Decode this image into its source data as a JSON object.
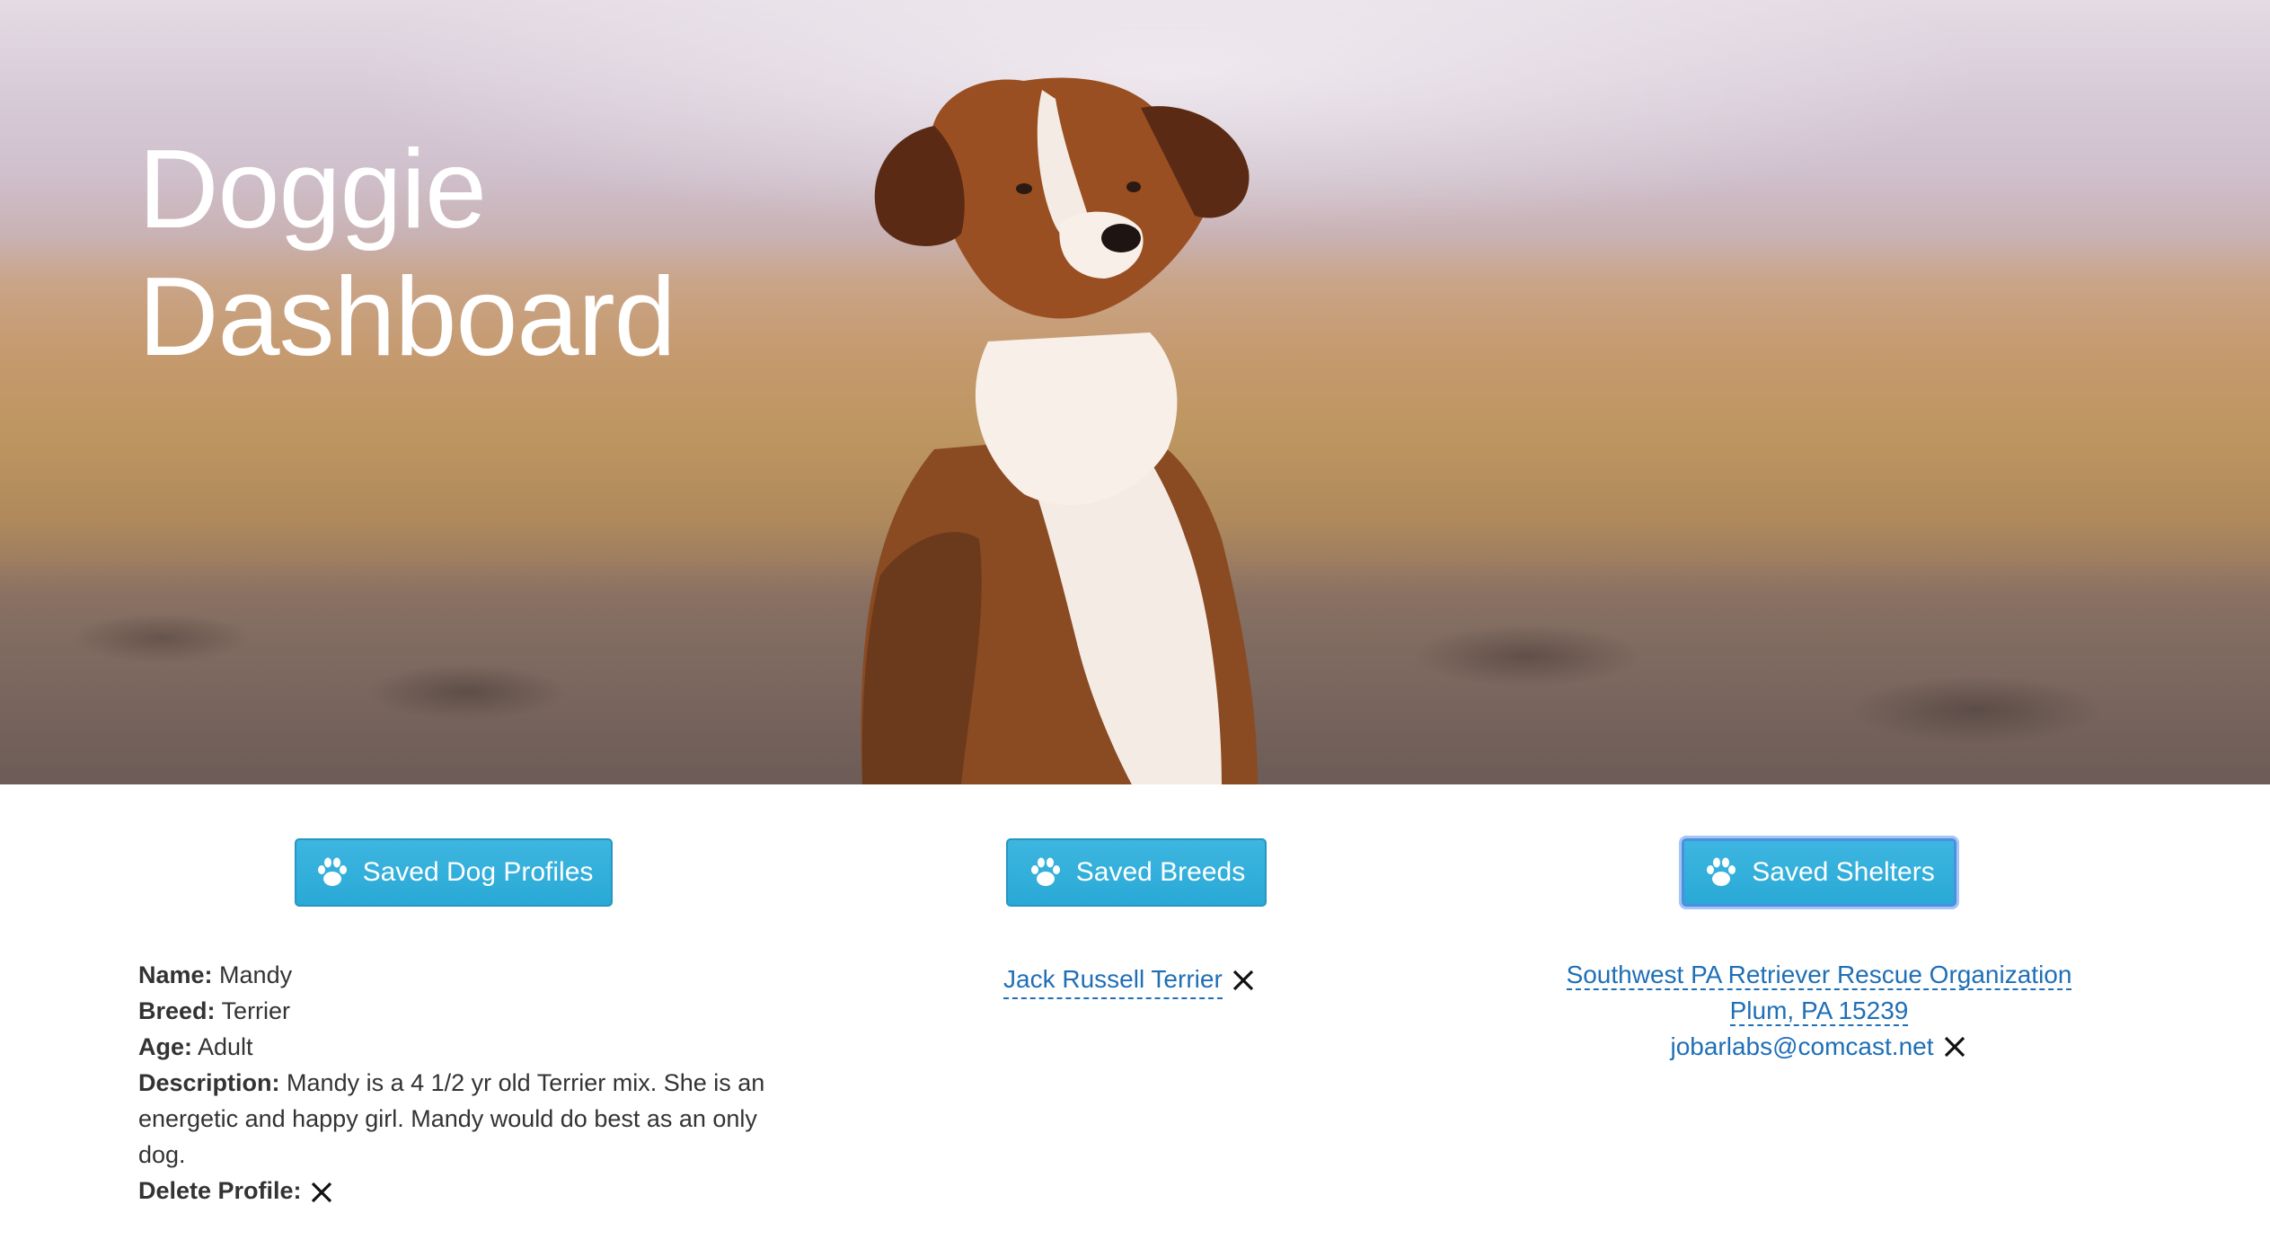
{
  "hero": {
    "title_line1": "Doggie",
    "title_line2": "Dashboard"
  },
  "buttons": {
    "dog_profiles": "Saved Dog Profiles",
    "breeds": "Saved Breeds",
    "shelters": "Saved Shelters"
  },
  "profile": {
    "name_label": "Name:",
    "name": "Mandy",
    "breed_label": "Breed:",
    "breed": "Terrier",
    "age_label": "Age:",
    "age": "Adult",
    "description_label": "Description:",
    "description": "Mandy is a 4 1/2 yr old Terrier mix. She is an energetic and happy girl. Mandy would do best as an only dog.",
    "delete_label": "Delete Profile:"
  },
  "breeds": {
    "items": [
      {
        "name": "Jack Russell Terrier"
      }
    ]
  },
  "shelters": {
    "items": [
      {
        "name": "Southwest PA Retriever Rescue Organization",
        "location": "Plum, PA 15239",
        "email": "jobarlabs@comcast.net"
      }
    ]
  },
  "colors": {
    "button": "#2aa9d6",
    "link": "#1f6fb6",
    "text": "#333333"
  },
  "icons": {
    "button_icon": "paw-icon",
    "remove_icon": "close-icon"
  }
}
